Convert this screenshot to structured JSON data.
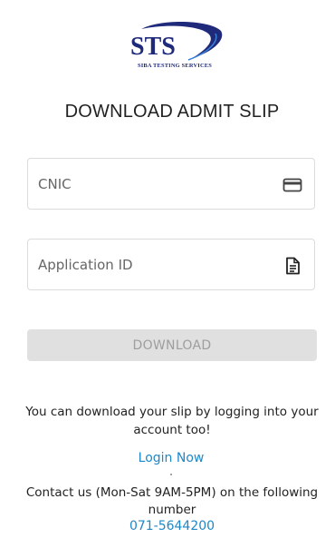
{
  "logo": {
    "mark": "STS",
    "subtitle": "SIBA TESTING SERVICES"
  },
  "page_title": "DOWNLOAD ADMIT SLIP",
  "form": {
    "cnic": {
      "placeholder": "CNIC",
      "value": "",
      "icon": "id-card-icon"
    },
    "application_id": {
      "placeholder": "Application ID",
      "value": "",
      "icon": "document-icon"
    },
    "download_label": "DOWNLOAD"
  },
  "note": "You can download your slip by logging into your account too!",
  "login_link": "Login Now",
  "contact": {
    "text": "Contact us (Mon-Sat 9AM-5PM) on the following number",
    "phone": "071-5644200"
  },
  "colors": {
    "brand": "#1f2a7a",
    "link": "#1e88c7",
    "button_disabled": "#e0e0e0"
  }
}
